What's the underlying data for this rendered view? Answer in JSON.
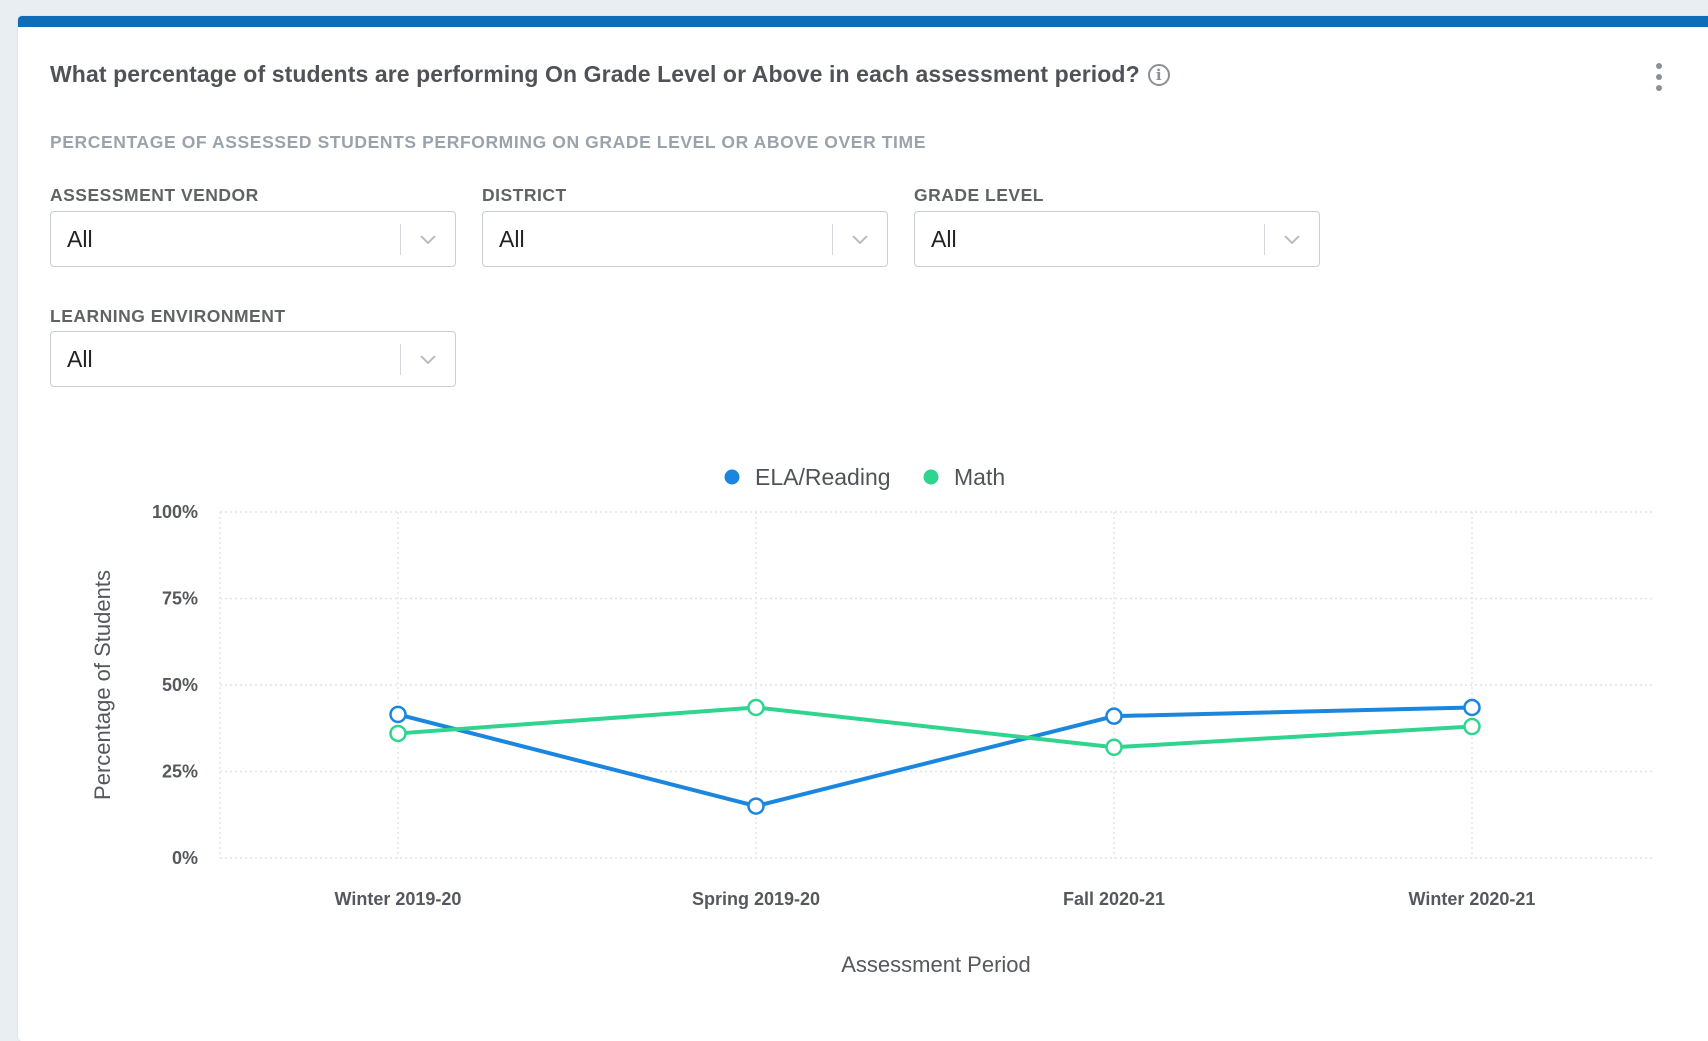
{
  "card": {
    "title": "What percentage of students are performing On Grade Level or Above in each assessment period?",
    "subtitle": "PERCENTAGE OF ASSESSED STUDENTS PERFORMING ON GRADE LEVEL OR ABOVE OVER TIME",
    "info_icon": "info-icon",
    "menu_icon": "kebab-menu-icon",
    "accent_color": "#0f6db8"
  },
  "filters": {
    "assessment_vendor": {
      "label": "ASSESSMENT VENDOR",
      "value": "All"
    },
    "district": {
      "label": "DISTRICT",
      "value": "All"
    },
    "grade_level": {
      "label": "GRADE LEVEL",
      "value": "All"
    },
    "learning_environment": {
      "label": "LEARNING ENVIRONMENT",
      "value": "All"
    }
  },
  "chart_data": {
    "type": "line",
    "categories": [
      "Winter 2019-20",
      "Spring 2019-20",
      "Fall 2020-21",
      "Winter 2020-21"
    ],
    "series": [
      {
        "name": "ELA/Reading",
        "color": "#1a86e0",
        "values": [
          41.5,
          15,
          41,
          43.5
        ]
      },
      {
        "name": "Math",
        "color": "#2fd48f",
        "values": [
          36,
          43.5,
          32,
          38
        ]
      }
    ],
    "xlabel": "Assessment Period",
    "ylabel": "Percentage of Students",
    "ylim": [
      0,
      100
    ],
    "yticks": [
      "0%",
      "25%",
      "50%",
      "75%",
      "100%"
    ],
    "grid": true,
    "legend_position": "top-center"
  }
}
